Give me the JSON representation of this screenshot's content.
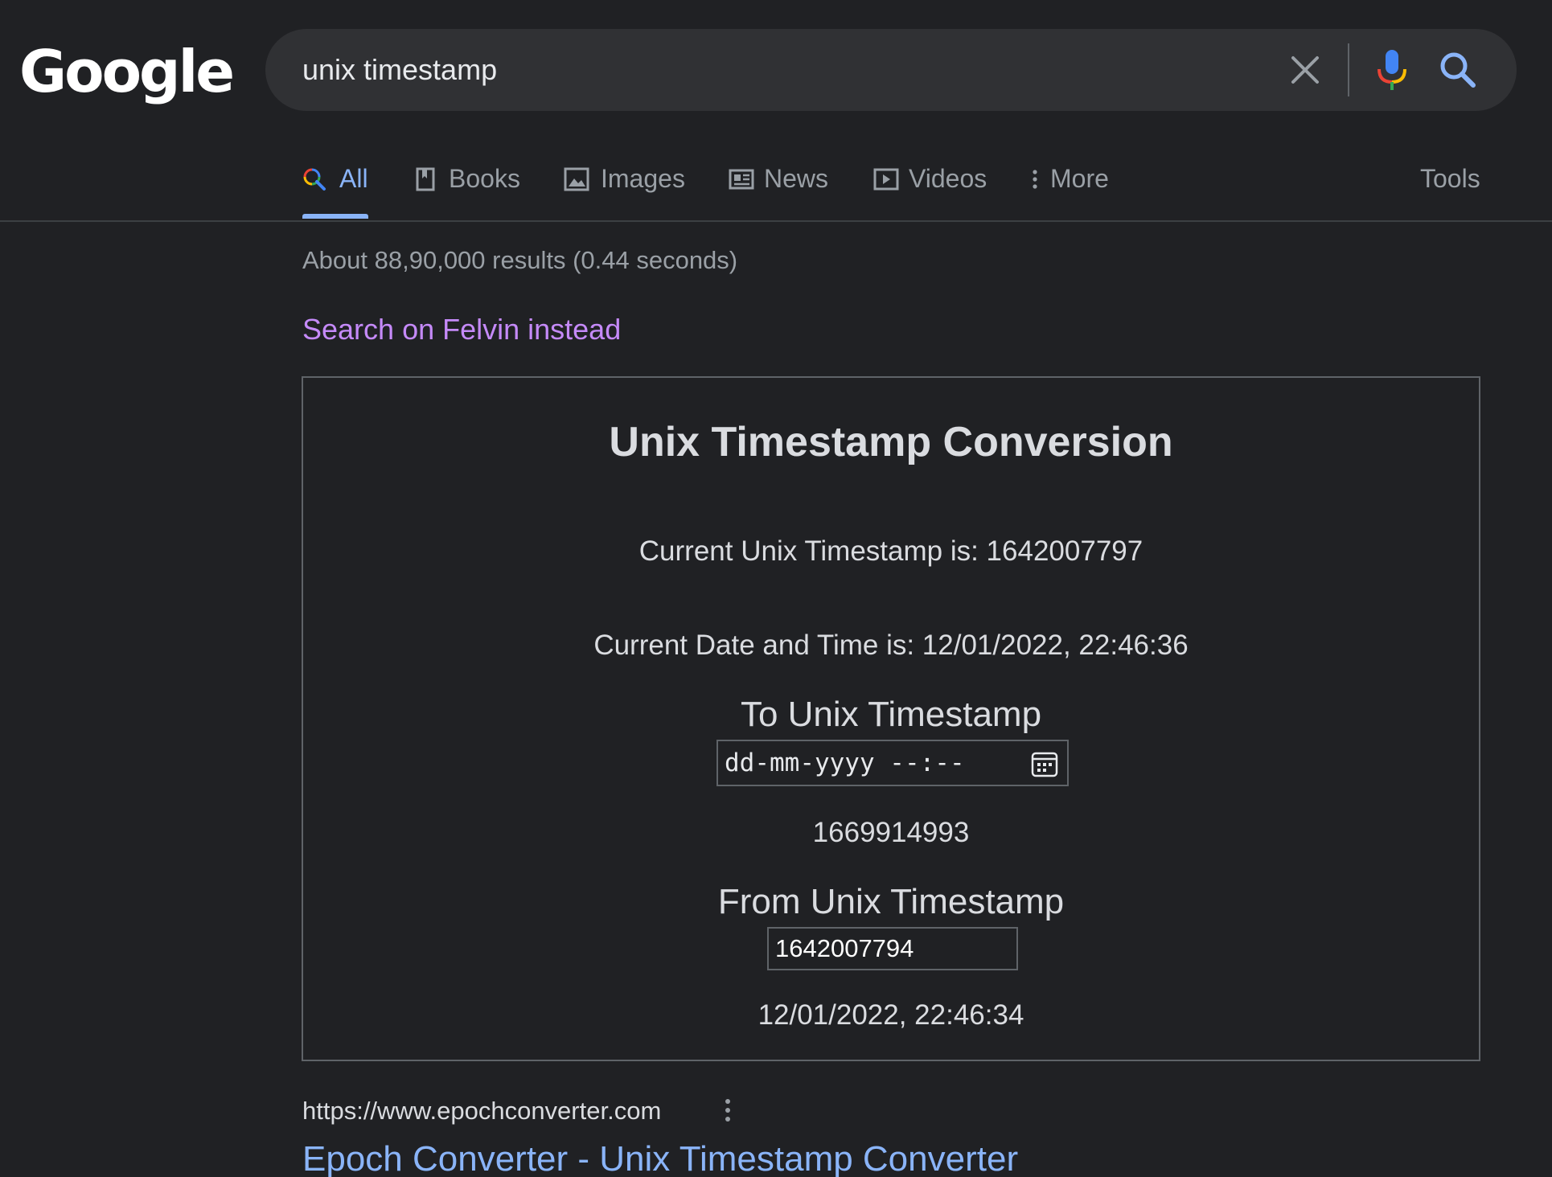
{
  "header": {
    "logo_text": "Google",
    "search_query": "unix timestamp"
  },
  "icons": {
    "clear": "close-icon",
    "mic": "mic-icon",
    "search": "search-icon",
    "calendar": "calendar-icon",
    "more": "more-vert-icon"
  },
  "tabs": [
    {
      "label": "All",
      "icon": "search-icon",
      "active": true
    },
    {
      "label": "Books",
      "icon": "book-icon"
    },
    {
      "label": "Images",
      "icon": "image-icon"
    },
    {
      "label": "News",
      "icon": "news-icon"
    },
    {
      "label": "Videos",
      "icon": "video-icon"
    },
    {
      "label": "More",
      "icon": "more-vert-icon"
    }
  ],
  "tools_label": "Tools",
  "results": {
    "stats": "About 88,90,000 results (0.44 seconds)",
    "alt_search": "Search on Felvin instead"
  },
  "widget": {
    "title": "Unix Timestamp Conversion",
    "current_timestamp": "Current Unix Timestamp is: 1642007797",
    "current_datetime": "Current Date and Time is: 12/01/2022, 22:46:36",
    "to_heading": "To Unix Timestamp",
    "to_placeholder": "dd-mm-yyyy --:--",
    "to_result": "1669914993",
    "from_heading": "From Unix Timestamp",
    "from_value": "1642007794",
    "from_result": "12/01/2022, 22:46:34"
  },
  "first_result": {
    "url": "https://www.epochconverter.com",
    "title": "Epoch Converter - Unix Timestamp Converter"
  },
  "colors": {
    "background": "#202124",
    "link": "#8ab4f8",
    "visited": "#c58af9",
    "search_bar": "#303134"
  }
}
